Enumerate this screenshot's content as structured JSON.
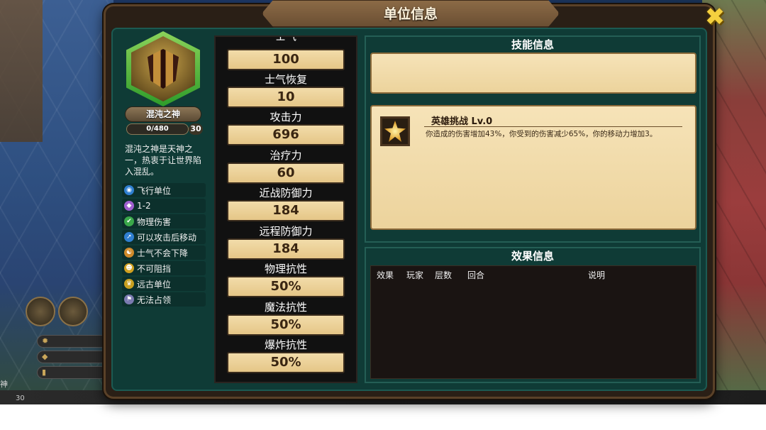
{
  "dialog": {
    "title": "单位信息",
    "close_icon": "close-x-icon"
  },
  "unit": {
    "name": "混沌之神",
    "xp": "0/480",
    "level": "30",
    "description": "混沌之神是天神之一，热衷于让世界陷入混乱。",
    "traits": [
      {
        "icon": "flying-icon",
        "label": "飞行单位",
        "color": "#2f7fd0"
      },
      {
        "icon": "range-icon",
        "label": "1-2",
        "color": "#a05fd0"
      },
      {
        "icon": "physical-damage-icon",
        "label": "物理伤害",
        "color": "#3aa84a"
      },
      {
        "icon": "move-after-attack-icon",
        "label": "可以攻击后移动",
        "color": "#2f7fd0"
      },
      {
        "icon": "morale-icon",
        "label": "士气不会下降",
        "color": "#d08a2a"
      },
      {
        "icon": "unstoppable-icon",
        "label": "不可阻挡",
        "color": "#d0a020"
      },
      {
        "icon": "ancient-icon",
        "label": "远古单位",
        "color": "#c9a020"
      },
      {
        "icon": "no-occupy-icon",
        "label": "无法占领",
        "color": "#7a7ab0"
      }
    ]
  },
  "stats": [
    {
      "label": "士气",
      "value": "100"
    },
    {
      "label": "士气恢复",
      "value": "10"
    },
    {
      "label": "攻击力",
      "value": "696"
    },
    {
      "label": "治疗力",
      "value": "60"
    },
    {
      "label": "近战防御力",
      "value": "184"
    },
    {
      "label": "远程防御力",
      "value": "184"
    },
    {
      "label": "物理抗性",
      "value": "50%"
    },
    {
      "label": "魔法抗性",
      "value": "50%"
    },
    {
      "label": "爆炸抗性",
      "value": "50%"
    }
  ],
  "skill_panel": {
    "header": "技能信息",
    "skill_name": "英雄挑战 Lv.0",
    "skill_desc": "你造成的伤害增加43%，你受到的伤害减少65%，你的移动力增加3。",
    "skill_icon": "hero-challenge-icon"
  },
  "effect_panel": {
    "header": "效果信息",
    "columns": [
      "效果",
      "玩家",
      "层数",
      "回合",
      "说明"
    ]
  },
  "background": {
    "bottom_left_name": "神",
    "bottom_left_level": "30"
  }
}
